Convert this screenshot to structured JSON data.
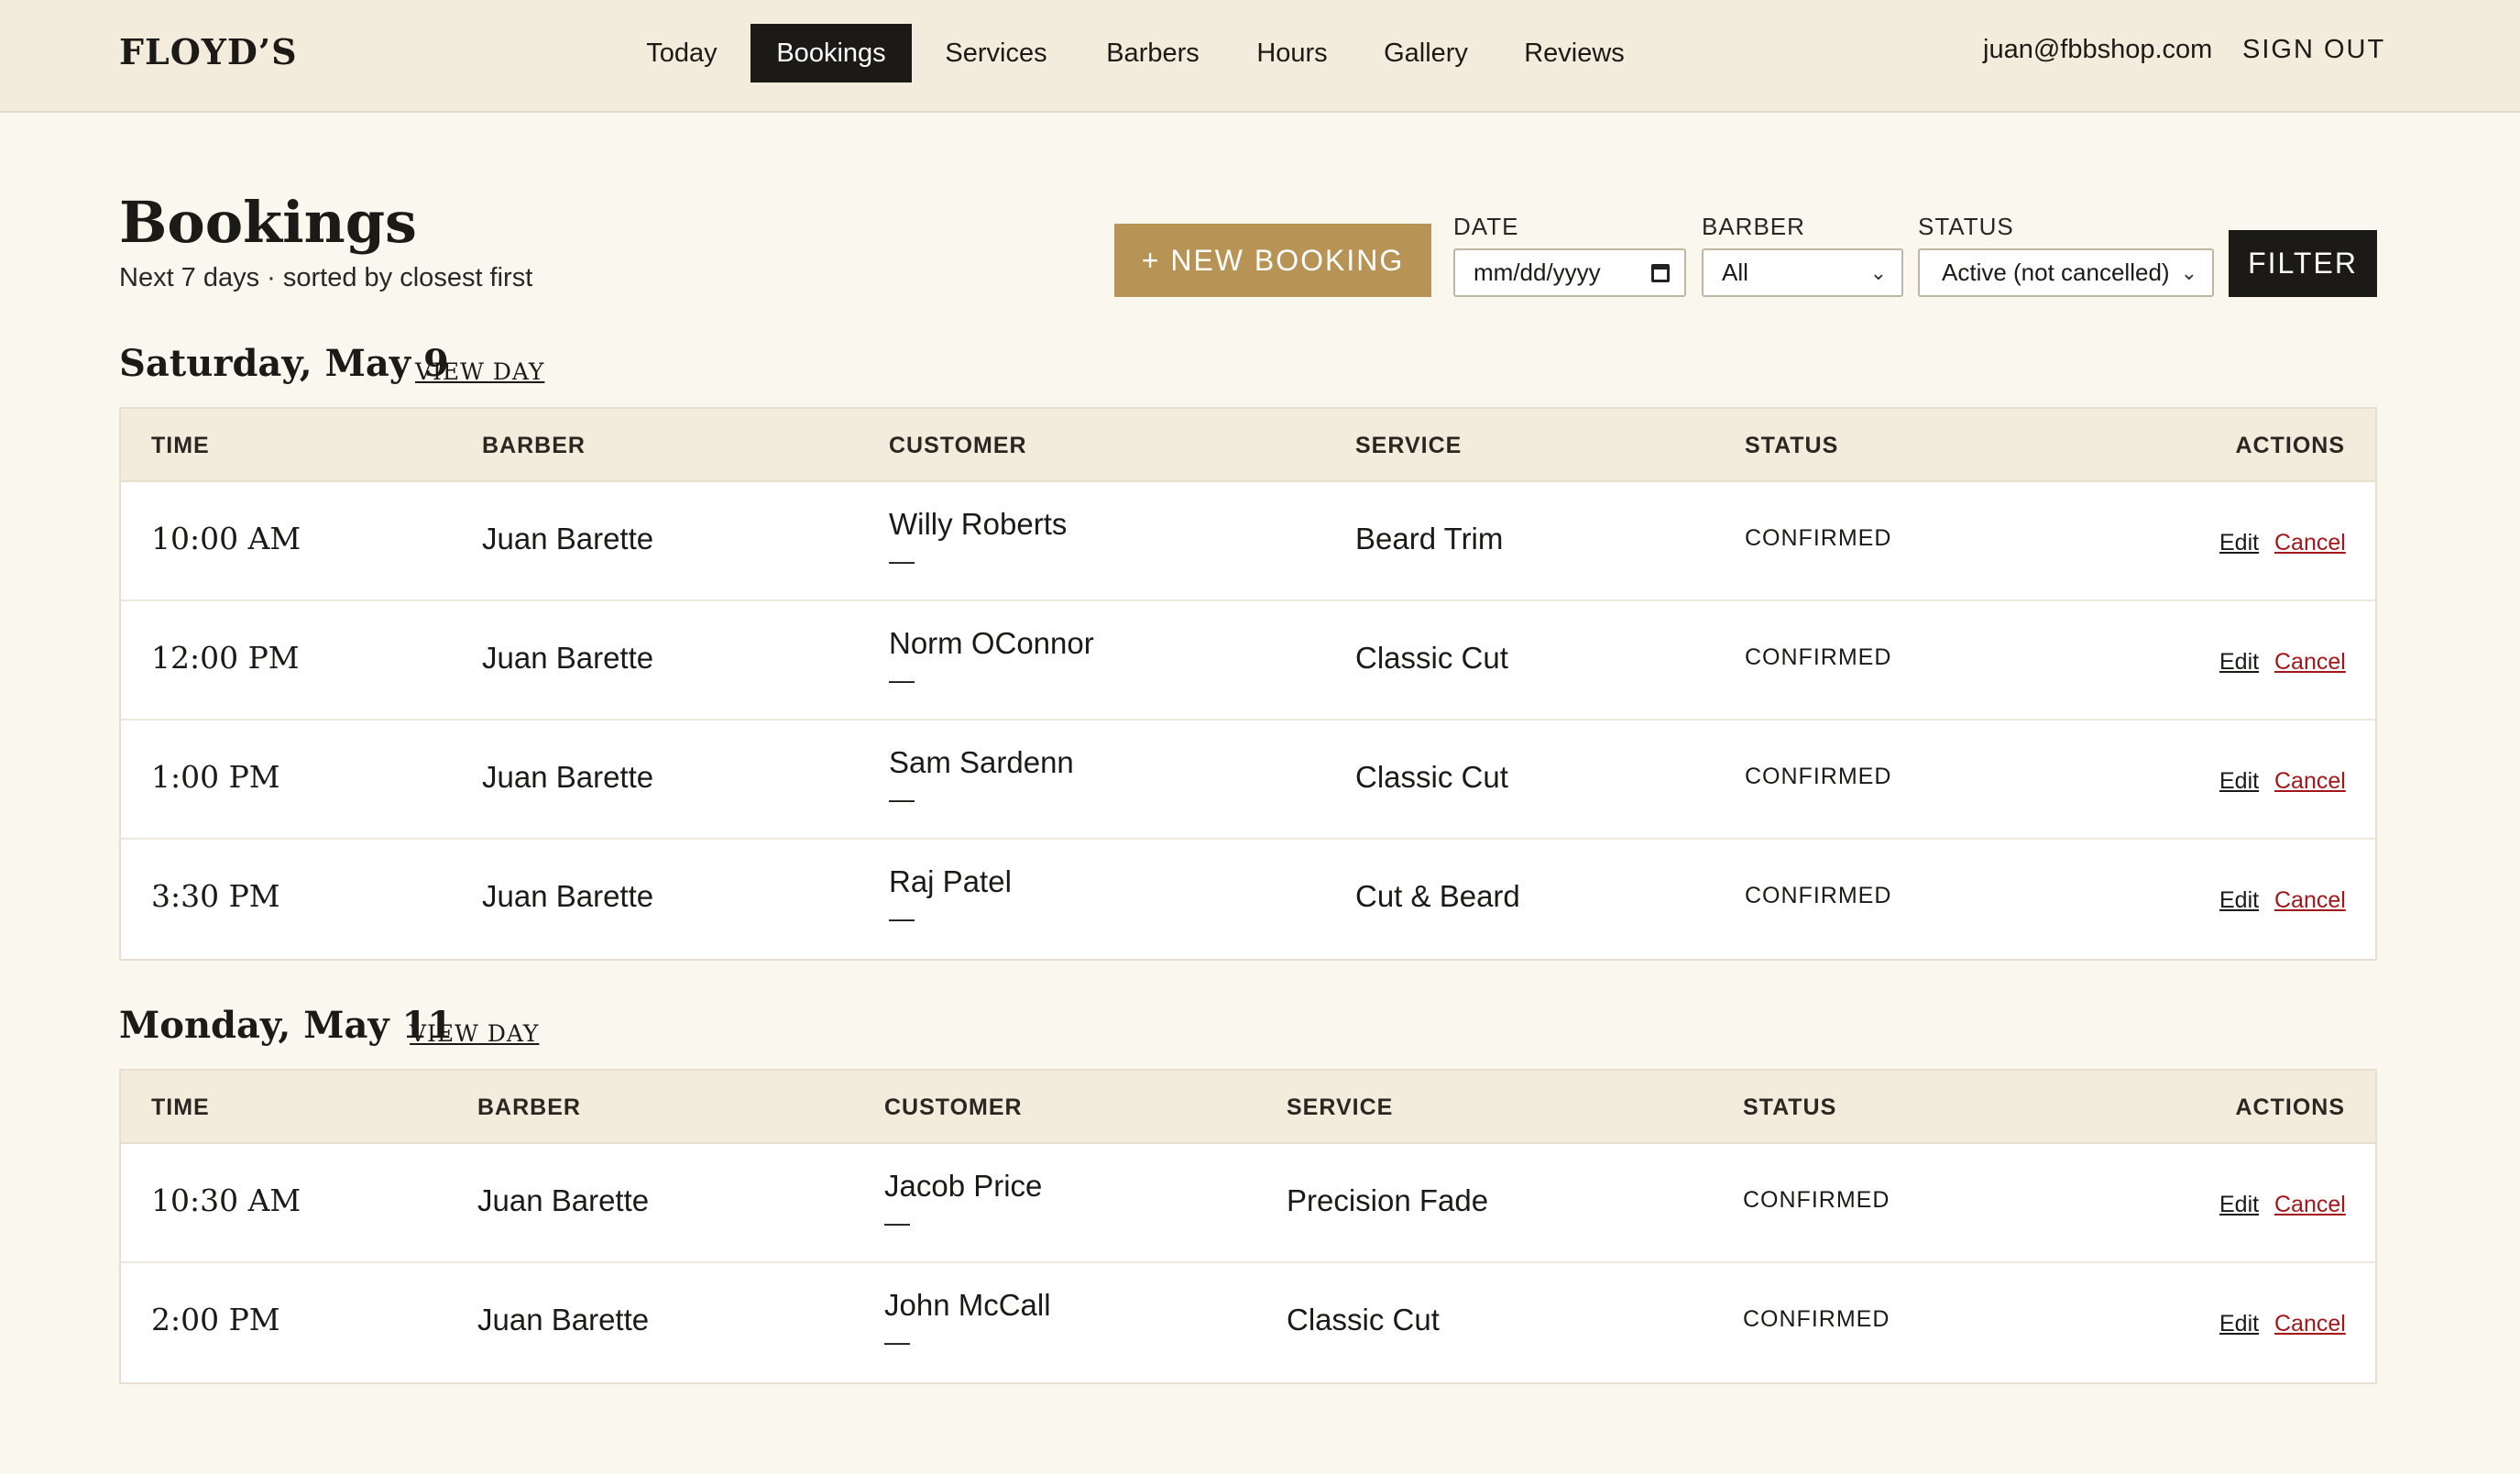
{
  "app": {
    "brand": "FLOYD’S",
    "nav": [
      {
        "label": "Today"
      },
      {
        "label": "Bookings",
        "active": true
      },
      {
        "label": "Services"
      },
      {
        "label": "Barbers"
      },
      {
        "label": "Hours"
      },
      {
        "label": "Gallery"
      },
      {
        "label": "Reviews"
      }
    ],
    "user_email": "juan@fbbshop.com",
    "sign_out": "SIGN OUT"
  },
  "page": {
    "title": "Bookings",
    "subtitle": "Next 7 days · sorted by closest first",
    "new_booking": "+ NEW BOOKING",
    "filters": {
      "date": {
        "label": "DATE",
        "placeholder": "mm/dd/yyyy",
        "icon": "calendar-icon"
      },
      "barber": {
        "label": "BARBER",
        "value": "All"
      },
      "status": {
        "label": "STATUS",
        "value": "Active (not cancelled)"
      },
      "submit": "FILTER"
    }
  },
  "columns": [
    "TIME",
    "BARBER",
    "CUSTOMER",
    "SERVICE",
    "STATUS",
    "ACTIONS"
  ],
  "days": [
    {
      "title": "Saturday, May 9",
      "view_day": "VIEW DAY",
      "rows": [
        {
          "time": "10:00 AM",
          "barber": "Juan Barette",
          "customer": "Willy Roberts",
          "contact": "—",
          "service": "Beard Trim",
          "status": "CONFIRMED",
          "edit": "Edit",
          "cancel": "Cancel"
        },
        {
          "time": "12:00 PM",
          "barber": "Juan Barette",
          "customer": "Norm OConnor",
          "contact": "—",
          "service": "Classic Cut",
          "status": "CONFIRMED",
          "edit": "Edit",
          "cancel": "Cancel"
        },
        {
          "time": "1:00 PM",
          "barber": "Juan Barette",
          "customer": "Sam Sardenn",
          "contact": "—",
          "service": "Classic Cut",
          "status": "CONFIRMED",
          "edit": "Edit",
          "cancel": "Cancel"
        },
        {
          "time": "3:30 PM",
          "barber": "Juan Barette",
          "customer": "Raj Patel",
          "contact": "—",
          "service": "Cut & Beard",
          "status": "CONFIRMED",
          "edit": "Edit",
          "cancel": "Cancel"
        }
      ]
    },
    {
      "title": "Monday, May 11",
      "view_day": "VIEW DAY",
      "rows": [
        {
          "time": "10:30 AM",
          "barber": "Juan Barette",
          "customer": "Jacob Price",
          "contact": "—",
          "service": "Precision Fade",
          "status": "CONFIRMED",
          "edit": "Edit",
          "cancel": "Cancel"
        },
        {
          "time": "2:00 PM",
          "barber": "Juan Barette",
          "customer": "John McCall",
          "contact": "—",
          "service": "Classic Cut",
          "status": "CONFIRMED",
          "edit": "Edit",
          "cancel": "Cancel"
        }
      ]
    }
  ],
  "colors": {
    "accent": "#b79356",
    "dark": "#1c1a16",
    "cancel": "#a4161a",
    "header_bg": "#f3ecdd",
    "page_bg": "#faf7ef"
  }
}
